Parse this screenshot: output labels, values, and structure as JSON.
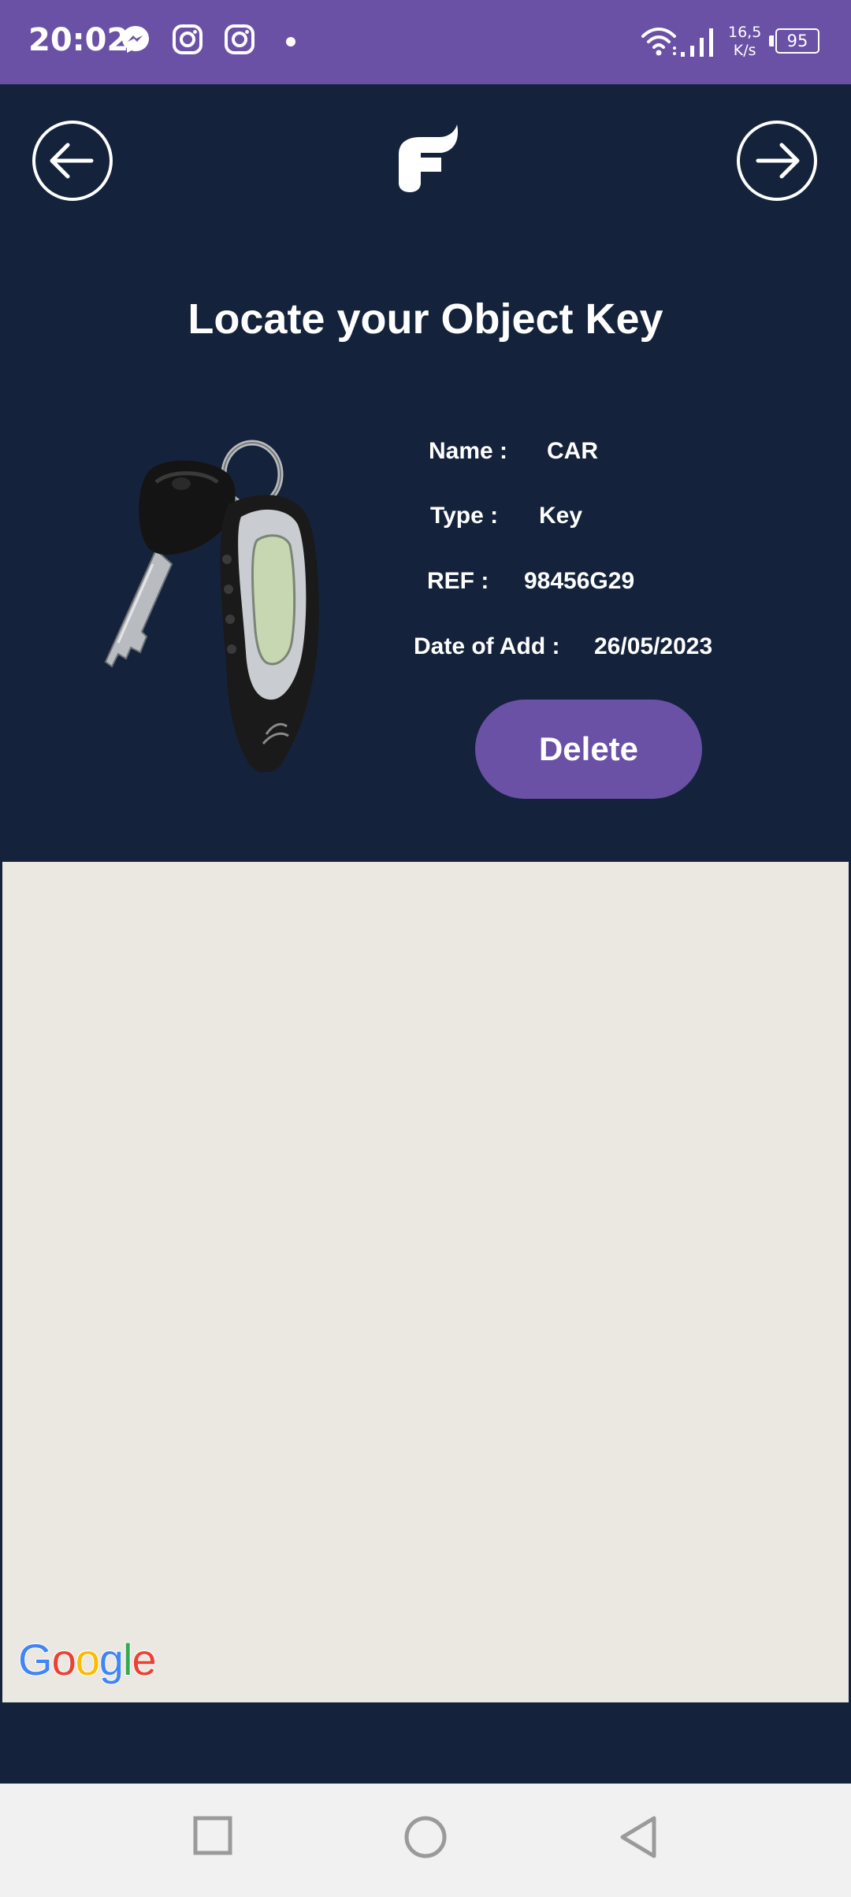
{
  "status_bar": {
    "time": "20:02",
    "icons": [
      "messenger-icon",
      "instagram-icon",
      "instagram-icon",
      "dot-icon",
      "wifi-icon",
      "signal-icon"
    ],
    "net_speed_value": "16,5",
    "net_speed_unit": "K/s",
    "battery": "95"
  },
  "header": {
    "back_icon": "arrow-left-circle-icon",
    "forward_icon": "arrow-right-circle-icon",
    "logo_icon": "app-logo-f"
  },
  "page": {
    "title": "Locate your Object Key"
  },
  "object": {
    "image": "car-key-fob",
    "name_label": "Name :",
    "name_value": "CAR",
    "type_label": "Type :",
    "type_value": "Key",
    "ref_label": "REF :",
    "ref_value": "98456G29",
    "date_label": "Date of Add :",
    "date_value": "26/05/2023",
    "delete_label": "Delete"
  },
  "map": {
    "attribution": "Google"
  },
  "nav_bar": {
    "icons": [
      "recents-square-icon",
      "home-circle-icon",
      "back-triangle-icon"
    ]
  },
  "colors": {
    "status_bar": "#6a51a6",
    "background": "#14233b",
    "accent": "#6a51a6",
    "map": "#ebe8e2",
    "nav_bar": "#f1f1f1"
  }
}
